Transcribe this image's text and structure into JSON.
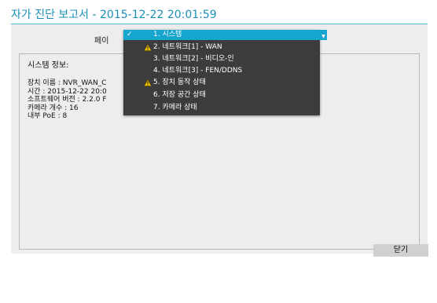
{
  "window": {
    "title": "자가 진단 보고서 - 2015-12-22 20:01:59"
  },
  "page_selector": {
    "label": "페이",
    "options": [
      {
        "label": "1. 시스템",
        "selected": true,
        "warning": false
      },
      {
        "label": "2. 네트워크[1] - WAN",
        "selected": false,
        "warning": true
      },
      {
        "label": "3. 네트워크[2] - 비디오-인",
        "selected": false,
        "warning": false
      },
      {
        "label": "4. 네트워크[3] - FEN/DDNS",
        "selected": false,
        "warning": false
      },
      {
        "label": "5. 장치 동작 상태",
        "selected": false,
        "warning": true
      },
      {
        "label": "6. 저장 공간 상태",
        "selected": false,
        "warning": false
      },
      {
        "label": "7. 카메라 상태",
        "selected": false,
        "warning": false
      }
    ]
  },
  "system_info": {
    "title": "시스템 정보:",
    "lines": [
      "장치 이름 : NVR_WAN_C",
      "시간 : 2015-12-22 20:0",
      "소프트웨어 버전 : 2.2.0 F",
      "카메라 개수 : 16",
      "내부 PoE : 8"
    ]
  },
  "buttons": {
    "close_label": "닫기"
  },
  "colors": {
    "accent": "#16a5cc",
    "title": "#1a8fb8",
    "dropdown_bg": "#3c3c3c",
    "warning": "#f2c200",
    "frame_bg": "#ededed"
  },
  "icons": {
    "check": "checkmark-icon",
    "warning": "warning-icon",
    "dropdown_arrow": "chevron-down-icon"
  }
}
